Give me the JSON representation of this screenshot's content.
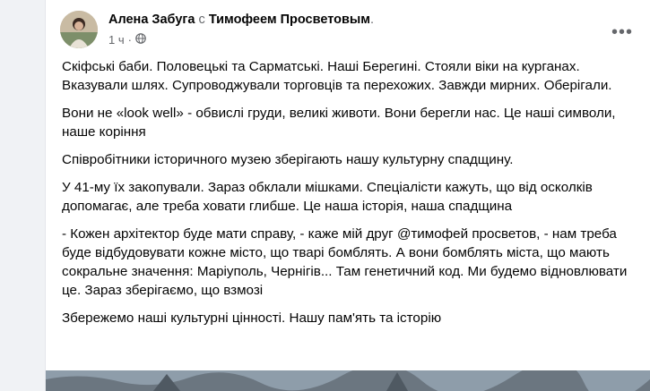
{
  "post": {
    "author": "Алена Забуга",
    "connector": "с",
    "tagged": "Тимофеем Просветовым",
    "tagged_suffix": ".",
    "time": "1 ч",
    "time_sep": "·",
    "more_icon": "ellipsis-icon",
    "audience_icon": "globe-icon",
    "paragraphs": [
      "Скіфські баби. Половецькі та Сарматські. Наші Берегині. Стояли віки на курганах. Вказували шлях. Супроводжували торговців та перехожих. Завжди мирних. Оберігали.",
      "Вони не «look well» - обвислі груди, великі животи. Вони берегли нас. Це наші символи, наше коріння",
      "Співробітники історичного музею зберігають нашу культурну спадщину.",
      "У 41-му їх закопували. Зараз обклали мішками. Спеціалісти кажуть, що від осколків допомагає, але треба ховати глибше. Це наша історія, наша спадщина",
      "- Кожен архітектор буде мати справу, - каже мій друг @тимофей просветов, - нам треба буде відбудовувати кожне місто, що тварі бомблять. А вони бомблять міста, що мають сокральне значення: Маріуполь, Чернігів... Там генетичний код. Ми будемо відновлювати це. Зараз зберігаємо, що взмозі",
      "Збережемо наші культурні цінності. Нашу пам'ять та історію"
    ]
  },
  "colors": {
    "text": "#050505",
    "secondary": "#65676b",
    "background": "#f0f2f5",
    "card": "#ffffff"
  }
}
